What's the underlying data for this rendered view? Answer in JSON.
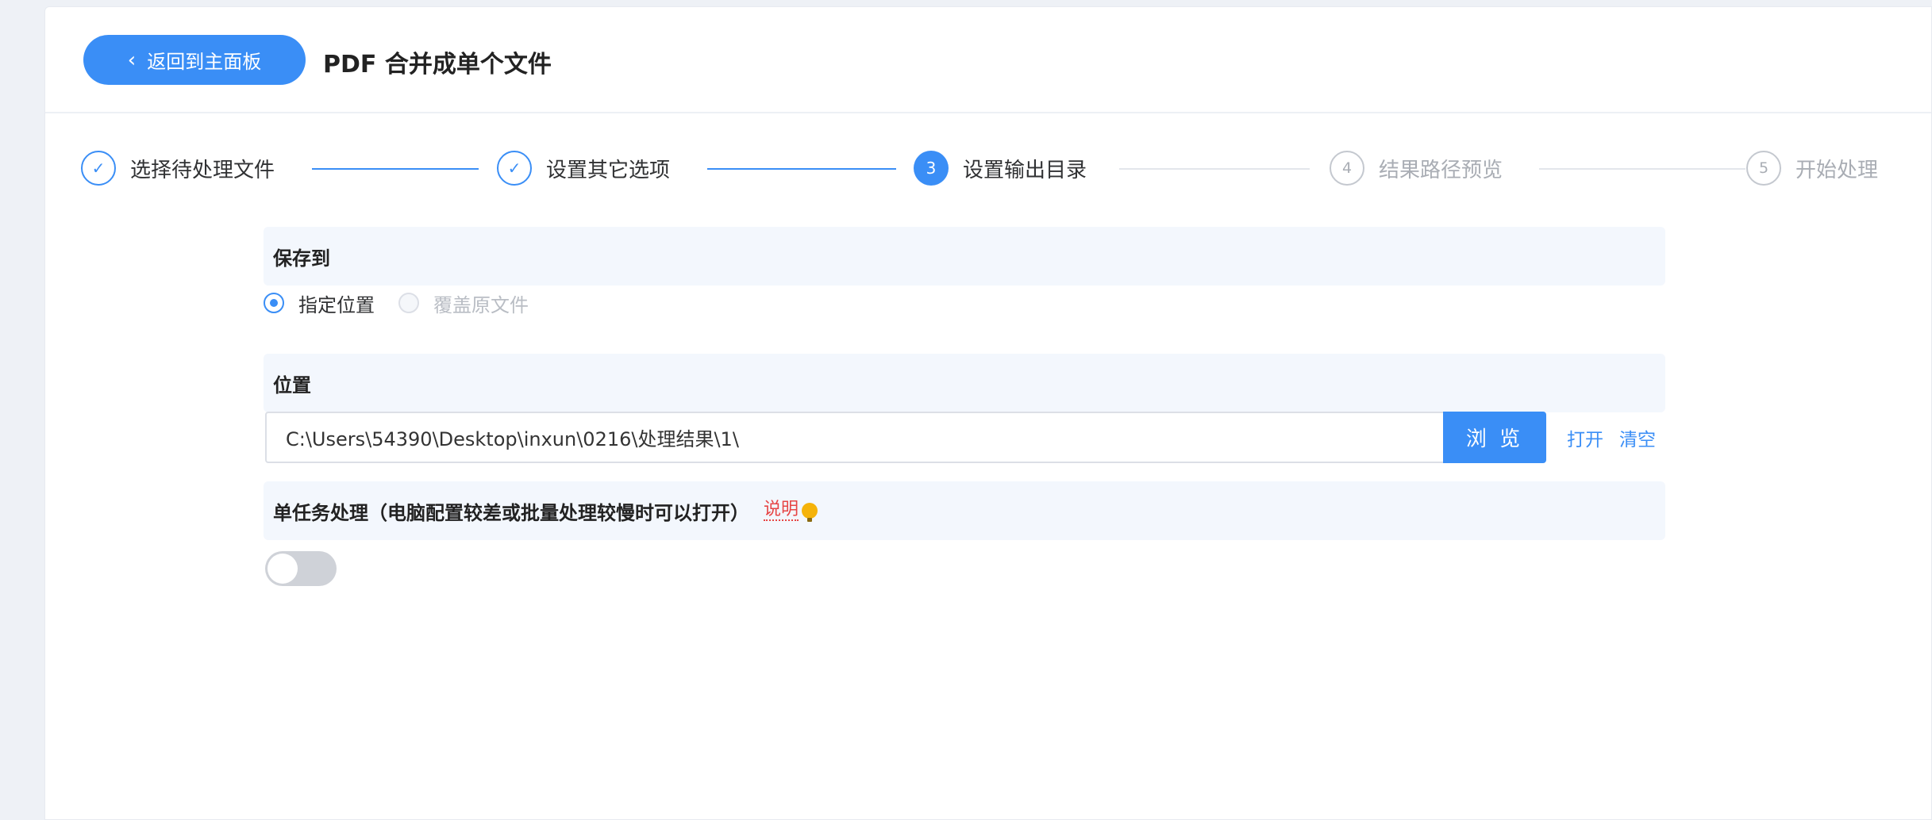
{
  "header": {
    "back_label": "返回到主面板",
    "title": "PDF 合并成单个文件"
  },
  "steps": [
    {
      "label": "选择待处理文件",
      "state": "done",
      "marker": "✓"
    },
    {
      "label": "设置其它选项",
      "state": "done",
      "marker": "✓"
    },
    {
      "label": "设置输出目录",
      "state": "active",
      "marker": "3"
    },
    {
      "label": "结果路径预览",
      "state": "todo",
      "marker": "4"
    },
    {
      "label": "开始处理",
      "state": "todo",
      "marker": "5"
    }
  ],
  "save_to": {
    "title": "保存到",
    "options": [
      {
        "label": "指定位置",
        "selected": true,
        "enabled": true
      },
      {
        "label": "覆盖原文件",
        "selected": false,
        "enabled": false
      }
    ]
  },
  "location": {
    "title": "位置",
    "path_value": "C:\\Users\\54390\\Desktop\\inxun\\0216\\处理结果\\1\\",
    "browse_label": "浏 览",
    "open_label": "打开",
    "clear_label": "清空"
  },
  "single_task": {
    "title": "单任务处理（电脑配置较差或批量处理较慢时可以打开）",
    "help_label": "说明",
    "enabled": false
  },
  "colors": {
    "accent": "#3a8ef6",
    "help": "#e64545",
    "bulb": "#f5b30a"
  }
}
